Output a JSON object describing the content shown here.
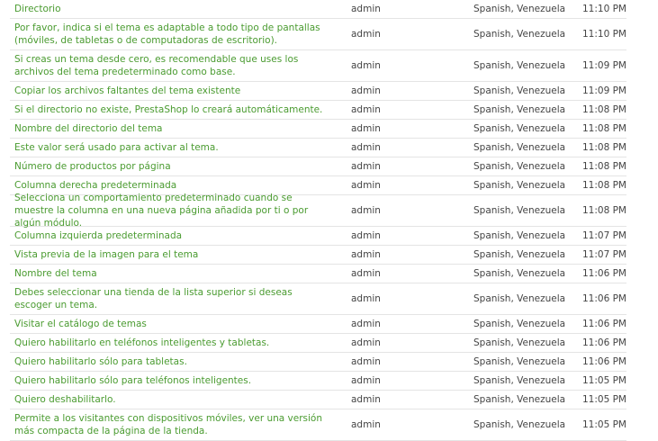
{
  "translations": {
    "rows": [
      {
        "text": "Directorio",
        "author": "admin",
        "language": "Spanish, Venezuela",
        "time": "11:10 PM"
      },
      {
        "text": "Por favor, indica si el tema es adaptable a todo tipo de pantallas (móviles, de tabletas o de computadoras de escritorio).",
        "author": "admin",
        "language": "Spanish, Venezuela",
        "time": "11:10 PM"
      },
      {
        "text": "Si creas un tema desde cero, es recomendable que uses los archivos del tema predeterminado como base.",
        "author": "admin",
        "language": "Spanish, Venezuela",
        "time": "11:09 PM"
      },
      {
        "text": "Copiar los archivos faltantes del tema existente",
        "author": "admin",
        "language": "Spanish, Venezuela",
        "time": "11:09 PM"
      },
      {
        "text": "Si el directorio no existe, PrestaShop lo creará automáticamente.",
        "author": "admin",
        "language": "Spanish, Venezuela",
        "time": "11:08 PM"
      },
      {
        "text": "Nombre del directorio del tema",
        "author": "admin",
        "language": "Spanish, Venezuela",
        "time": "11:08 PM"
      },
      {
        "text": "Este valor será usado para activar al tema.",
        "author": "admin",
        "language": "Spanish, Venezuela",
        "time": "11:08 PM"
      },
      {
        "text": "Número de productos por página",
        "author": "admin",
        "language": "Spanish, Venezuela",
        "time": "11:08 PM"
      },
      {
        "text": "Columna derecha predeterminada",
        "author": "admin",
        "language": "Spanish, Venezuela",
        "time": "11:08 PM"
      },
      {
        "text": "Selecciona un comportamiento predeterminado cuando se muestre la columna en una nueva página añadida por ti o por algún módulo.",
        "author": "admin",
        "language": "Spanish, Venezuela",
        "time": "11:08 PM"
      },
      {
        "text": "Columna izquierda predeterminada",
        "author": "admin",
        "language": "Spanish, Venezuela",
        "time": "11:07 PM"
      },
      {
        "text": "Vista previa de la imagen para el tema",
        "author": "admin",
        "language": "Spanish, Venezuela",
        "time": "11:07 PM"
      },
      {
        "text": "Nombre del tema",
        "author": "admin",
        "language": "Spanish, Venezuela",
        "time": "11:06 PM"
      },
      {
        "text": "Debes seleccionar una tienda de la lista superior si deseas escoger un tema.",
        "author": "admin",
        "language": "Spanish, Venezuela",
        "time": "11:06 PM"
      },
      {
        "text": "Visitar el catálogo de temas",
        "author": "admin",
        "language": "Spanish, Venezuela",
        "time": "11:06 PM"
      },
      {
        "text": "Quiero habilitarlo en teléfonos inteligentes y tabletas.",
        "author": "admin",
        "language": "Spanish, Venezuela",
        "time": "11:06 PM"
      },
      {
        "text": "Quiero habilitarlo sólo para tabletas.",
        "author": "admin",
        "language": "Spanish, Venezuela",
        "time": "11:06 PM"
      },
      {
        "text": "Quiero habilitarlo sólo para teléfonos inteligentes.",
        "author": "admin",
        "language": "Spanish, Venezuela",
        "time": "11:05 PM"
      },
      {
        "text": "Quiero deshabilitarlo.",
        "author": "admin",
        "language": "Spanish, Venezuela",
        "time": "11:05 PM"
      },
      {
        "text": "Permite a los visitantes con dispositivos móviles, ver una versión más compacta de la página de la tienda.",
        "author": "admin",
        "language": "Spanish, Venezuela",
        "time": "11:05 PM"
      }
    ]
  }
}
